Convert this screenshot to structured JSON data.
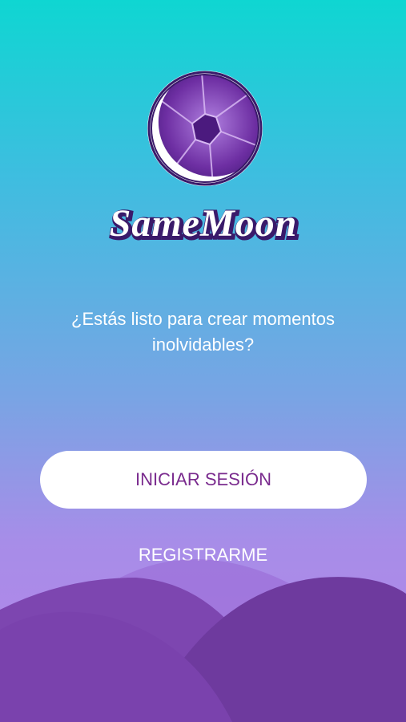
{
  "app": {
    "brand_name": "SameMoon",
    "tagline": "¿Estás listo para crear momentos inolvidables?"
  },
  "actions": {
    "login_label": "INICIAR SESIÓN",
    "register_label": "REGISTRARME"
  },
  "colors": {
    "gradient_top": "#0fd6d2",
    "gradient_bottom": "#b684ea",
    "brand_purple": "#7a2b8e",
    "hill_back": "#9a6ad6",
    "hill_mid": "#7d46b0",
    "hill_front": "#6e3a9e"
  },
  "icons": {
    "logo": "moon-aperture-logo-icon"
  }
}
